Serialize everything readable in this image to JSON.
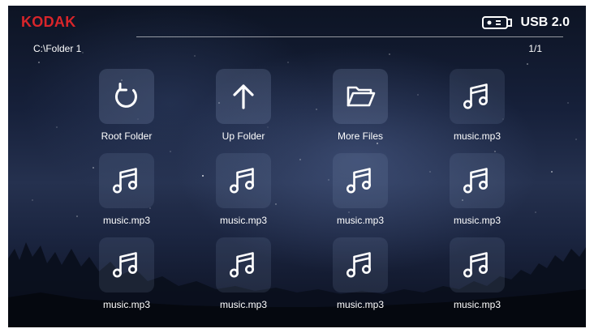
{
  "header": {
    "brand": "KODAK",
    "device": "USB 2.0",
    "path": "C:\\Folder 1",
    "page": "1/1"
  },
  "colors": {
    "brand": "#d9252a",
    "text": "#ffffff"
  },
  "files": [
    {
      "label": "Root Folder",
      "icon": "refresh-icon"
    },
    {
      "label": "Up Folder",
      "icon": "arrow-up-icon"
    },
    {
      "label": "More Files",
      "icon": "folder-open-icon"
    },
    {
      "label": "music.mp3",
      "icon": "music-note-icon"
    },
    {
      "label": "music.mp3",
      "icon": "music-note-icon"
    },
    {
      "label": "music.mp3",
      "icon": "music-note-icon"
    },
    {
      "label": "music.mp3",
      "icon": "music-note-icon"
    },
    {
      "label": "music.mp3",
      "icon": "music-note-icon"
    },
    {
      "label": "music.mp3",
      "icon": "music-note-icon"
    },
    {
      "label": "music.mp3",
      "icon": "music-note-icon"
    },
    {
      "label": "music.mp3",
      "icon": "music-note-icon"
    },
    {
      "label": "music.mp3",
      "icon": "music-note-icon"
    }
  ]
}
